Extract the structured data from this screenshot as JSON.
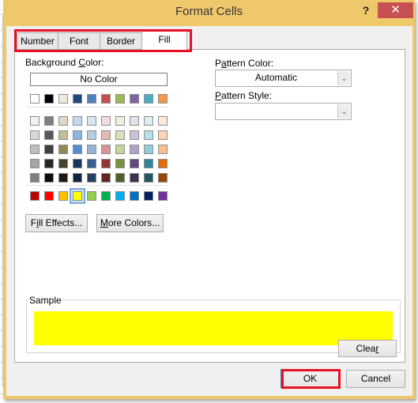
{
  "dialog": {
    "title": "Format Cells",
    "help_label": "?",
    "close_label": "✕",
    "frame_color": "#f0c86c"
  },
  "tabs": [
    {
      "label": "Number",
      "active": false
    },
    {
      "label": "Font",
      "active": false
    },
    {
      "label": "Border",
      "active": false
    },
    {
      "label": "Fill",
      "active": true
    }
  ],
  "background_color": {
    "label_pre": "Background ",
    "label_accel": "C",
    "label_post": "olor:",
    "no_color_label": "No Color",
    "theme_row": [
      "#ffffff",
      "#000000",
      "#eeece1",
      "#1f497d",
      "#4f81bd",
      "#c0504d",
      "#9bbb59",
      "#8064a2",
      "#4bacc6",
      "#f79646"
    ],
    "tint_rows": [
      [
        "#f2f2f2",
        "#7f7f7f",
        "#ddd9c3",
        "#c6d9f0",
        "#dbe5f1",
        "#f2dcdb",
        "#ebf1dd",
        "#e5e0ec",
        "#dbeef3",
        "#fdeada"
      ],
      [
        "#d8d8d8",
        "#595959",
        "#c4bd97",
        "#8db3e2",
        "#b8cce4",
        "#e5b9b7",
        "#d7e3bc",
        "#ccc1d9",
        "#b7dde8",
        "#fbd5b5"
      ],
      [
        "#bfbfbf",
        "#3f3f3f",
        "#938953",
        "#548dd4",
        "#95b3d7",
        "#d99694",
        "#c3d69b",
        "#b2a2c7",
        "#92cddc",
        "#fac08f"
      ],
      [
        "#a5a5a5",
        "#262626",
        "#494429",
        "#17365d",
        "#366092",
        "#953734",
        "#76923c",
        "#5f497a",
        "#31859b",
        "#e36c09"
      ],
      [
        "#7f7f7f",
        "#0c0c0c",
        "#1d1b10",
        "#0f243e",
        "#244061",
        "#632423",
        "#4f6128",
        "#3f3151",
        "#205867",
        "#974806"
      ]
    ],
    "standard_row": [
      "#c00000",
      "#ff0000",
      "#ffc000",
      "#ffff00",
      "#92d050",
      "#00b050",
      "#00b0f0",
      "#0070c0",
      "#002060",
      "#7030a0"
    ],
    "selected_standard_index": 3
  },
  "buttons": {
    "fill_effects": {
      "pre": "F",
      "accel": "i",
      "post": "ll Effects..."
    },
    "more_colors": {
      "pre": "",
      "accel": "M",
      "post": "ore Colors..."
    },
    "clear": {
      "pre": "Clea",
      "accel": "r",
      "post": ""
    },
    "ok": "OK",
    "cancel": "Cancel"
  },
  "pattern": {
    "color_label_pre": "P",
    "color_label_accel": "a",
    "color_label_post": "ttern Color:",
    "color_value": "Automatic",
    "style_label_accel": "P",
    "style_label_post": "attern Style:",
    "style_value": ""
  },
  "sample": {
    "label": "Sample",
    "color": "#ffff00"
  },
  "highlight_color": "#e81123"
}
